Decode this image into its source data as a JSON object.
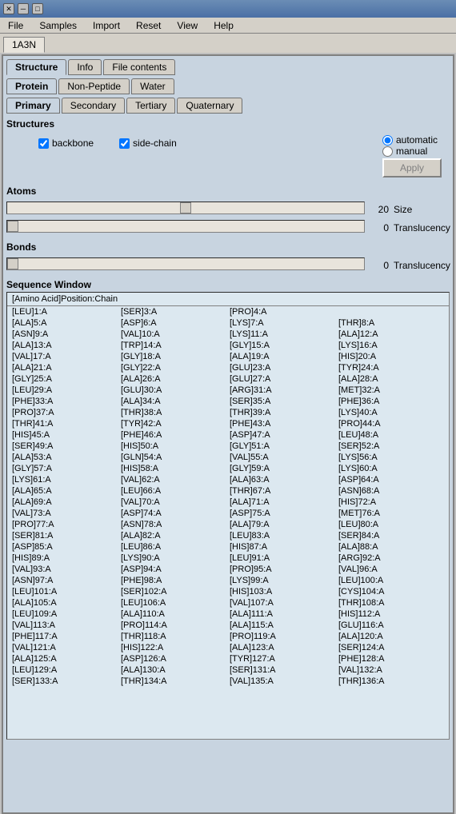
{
  "titlebar": {
    "buttons": [
      "close",
      "minimize",
      "maximize"
    ]
  },
  "menubar": {
    "items": [
      "File",
      "Samples",
      "Import",
      "Reset",
      "View",
      "Help"
    ]
  },
  "window_tab": "1A3N",
  "tabs_level1": {
    "items": [
      "Structure",
      "Info",
      "File contents"
    ],
    "active": "Structure"
  },
  "tabs_level2": {
    "items": [
      "Protein",
      "Non-Peptide",
      "Water"
    ],
    "active": "Protein"
  },
  "tabs_level3": {
    "items": [
      "Primary",
      "Secondary",
      "Tertiary",
      "Quaternary"
    ],
    "active": "Primary"
  },
  "structures": {
    "label": "Structures",
    "backbone_label": "backbone",
    "backbone_checked": true,
    "sidechain_label": "side-chain",
    "sidechain_checked": true,
    "radio_automatic_label": "automatic",
    "radio_manual_label": "manual",
    "radio_selected": "automatic",
    "apply_label": "Apply",
    "apply_disabled": true
  },
  "atoms": {
    "label": "Atoms",
    "size_value": 20,
    "size_label": "Size",
    "size_min": 0,
    "size_max": 40,
    "translucency_value": 0,
    "translucency_label": "Translucency",
    "translucency_min": 0,
    "translucency_max": 10
  },
  "bonds": {
    "label": "Bonds",
    "translucency_value": 0,
    "translucency_label": "Translucency",
    "translucency_min": 0,
    "translucency_max": 10
  },
  "sequence_window": {
    "label": "Sequence Window",
    "header": "[Amino Acid]Position:Chain",
    "rows": [
      [
        "[LEU]1:A",
        "[SER]3:A",
        "[PRO]4:A",
        ""
      ],
      [
        "[ALA]5:A",
        "[ASP]6:A",
        "[LYS]7:A",
        "[THR]8:A"
      ],
      [
        "[ASN]9:A",
        "[VAL]10:A",
        "[LYS]11:A",
        "[ALA]12:A"
      ],
      [
        "[ALA]13:A",
        "[TRP]14:A",
        "[GLY]15:A",
        "[LYS]16:A"
      ],
      [
        "[VAL]17:A",
        "[GLY]18:A",
        "[ALA]19:A",
        "[HIS]20:A"
      ],
      [
        "[ALA]21:A",
        "[GLY]22:A",
        "[GLU]23:A",
        "[TYR]24:A"
      ],
      [
        "[GLY]25:A",
        "[ALA]26:A",
        "[GLU]27:A",
        "[ALA]28:A"
      ],
      [
        "[LEU]29:A",
        "[GLU]30:A",
        "[ARG]31:A",
        "[MET]32:A"
      ],
      [
        "[PHE]33:A",
        "[ALA]34:A",
        "[SER]35:A",
        "[PHE]36:A"
      ],
      [
        "[PRO]37:A",
        "[THR]38:A",
        "[THR]39:A",
        "[LYS]40:A"
      ],
      [
        "[THR]41:A",
        "[TYR]42:A",
        "[PHE]43:A",
        "[PRO]44:A"
      ],
      [
        "[HIS]45:A",
        "[PHE]46:A",
        "[ASP]47:A",
        "[LEU]48:A"
      ],
      [
        "[SER]49:A",
        "[HIS]50:A",
        "[GLY]51:A",
        "[SER]52:A"
      ],
      [
        "[ALA]53:A",
        "[GLN]54:A",
        "[VAL]55:A",
        "[LYS]56:A"
      ],
      [
        "[GLY]57:A",
        "[HIS]58:A",
        "[GLY]59:A",
        "[LYS]60:A"
      ],
      [
        "[LYS]61:A",
        "[VAL]62:A",
        "[ALA]63:A",
        "[ASP]64:A"
      ],
      [
        "[ALA]65:A",
        "[LEU]66:A",
        "[THR]67:A",
        "[ASN]68:A"
      ],
      [
        "[ALA]69:A",
        "[VAL]70:A",
        "[ALA]71:A",
        "[HIS]72:A"
      ],
      [
        "[VAL]73:A",
        "[ASP]74:A",
        "[ASP]75:A",
        "[MET]76:A"
      ],
      [
        "[PRO]77:A",
        "[ASN]78:A",
        "[ALA]79:A",
        "[LEU]80:A"
      ],
      [
        "[SER]81:A",
        "[ALA]82:A",
        "[LEU]83:A",
        "[SER]84:A"
      ],
      [
        "[ASP]85:A",
        "[LEU]86:A",
        "[HIS]87:A",
        "[ALA]88:A"
      ],
      [
        "[HIS]89:A",
        "[LYS]90:A",
        "[LEU]91:A",
        "[ARG]92:A"
      ],
      [
        "[VAL]93:A",
        "[ASP]94:A",
        "[PRO]95:A",
        "[VAL]96:A"
      ],
      [
        "[ASN]97:A",
        "[PHE]98:A",
        "[LYS]99:A",
        "[LEU]100:A"
      ],
      [
        "[LEU]101:A",
        "[SER]102:A",
        "[HIS]103:A",
        "[CYS]104:A"
      ],
      [
        "[ALA]105:A",
        "[LEU]106:A",
        "[VAL]107:A",
        "[THR]108:A"
      ],
      [
        "[LEU]109:A",
        "[ALA]110:A",
        "[ALA]111:A",
        "[HIS]112:A"
      ],
      [
        "[VAL]113:A",
        "[PRO]114:A",
        "[ALA]115:A",
        "[GLU]116:A"
      ],
      [
        "[PHE]117:A",
        "[THR]118:A",
        "[PRO]119:A",
        "[ALA]120:A"
      ],
      [
        "[VAL]121:A",
        "[HIS]122:A",
        "[ALA]123:A",
        "[SER]124:A"
      ],
      [
        "[ALA]125:A",
        "[ASP]126:A",
        "[TYR]127:A",
        "[PHE]128:A"
      ],
      [
        "[LEU]129:A",
        "[ALA]130:A",
        "[SER]131:A",
        "[VAL]132:A"
      ],
      [
        "[SER]133:A",
        "[THR]134:A",
        "[VAL]135:A",
        "[THR]136:A"
      ]
    ]
  }
}
